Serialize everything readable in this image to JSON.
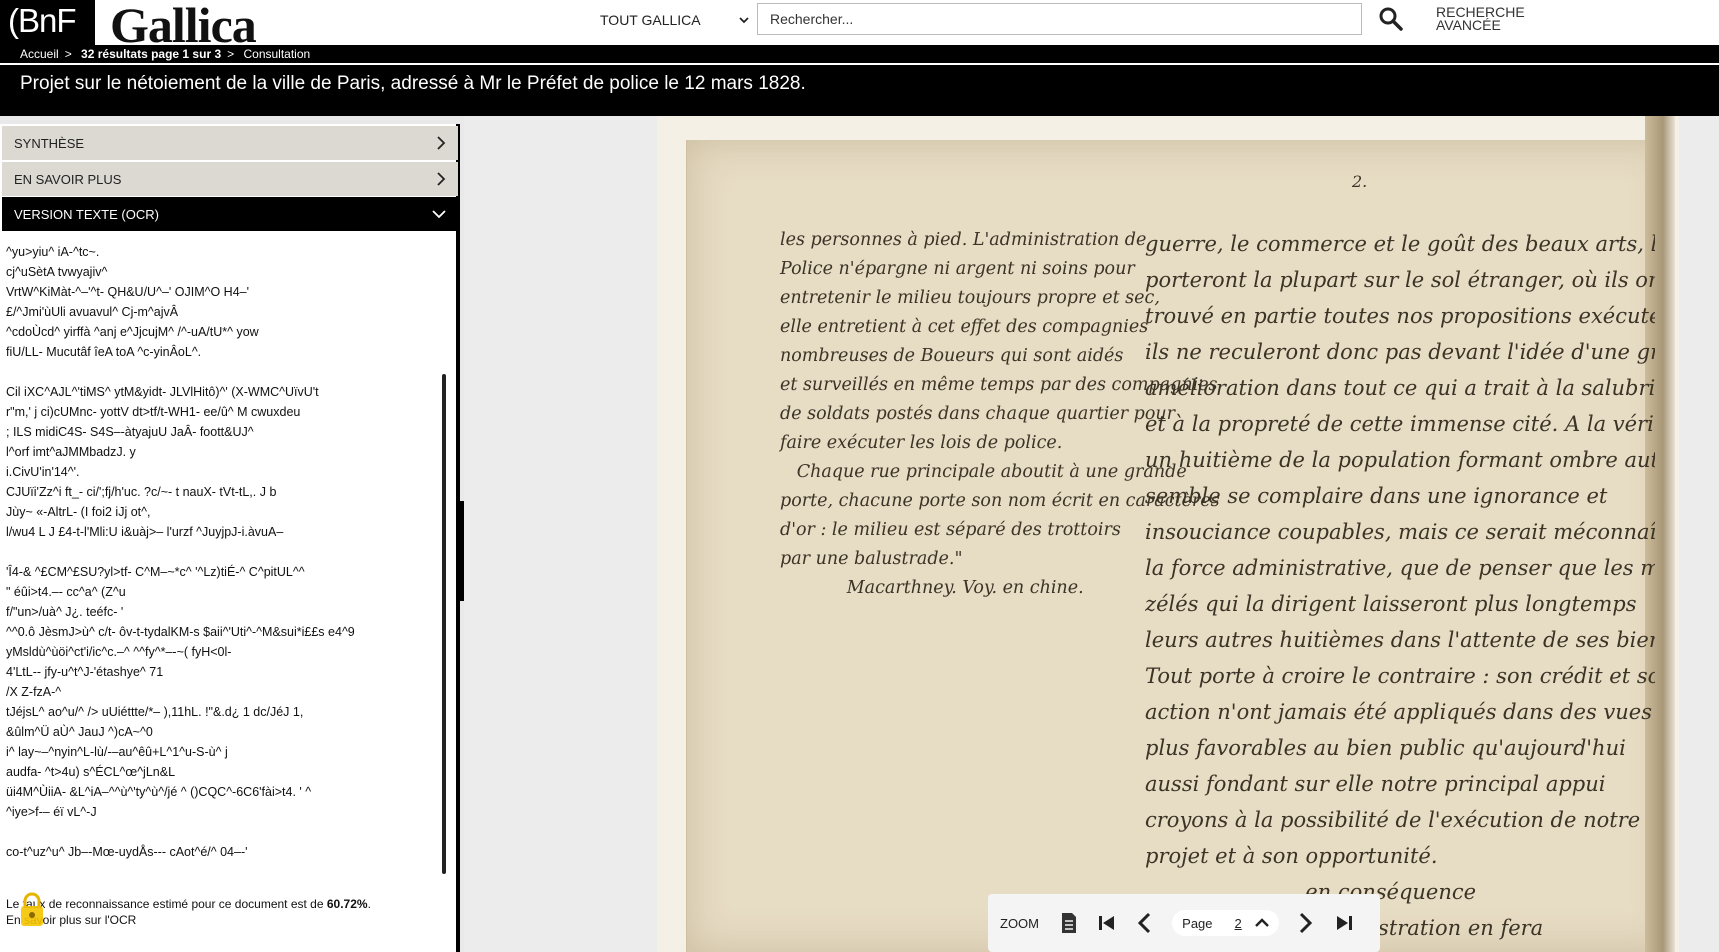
{
  "header": {
    "bnf_logo": "(BnF",
    "gallica_logo": "Gallica",
    "scope": "TOUT GALLICA",
    "search_placeholder": "Rechercher...",
    "advanced_search_line1": "RECHERCHE",
    "advanced_search_line2": "AVANCÉE"
  },
  "breadcrumb": {
    "home": "Accueil",
    "sep": ">",
    "results": "32 résultats page 1 sur 3",
    "current": "Consultation"
  },
  "document": {
    "title": "Projet sur le nétoiement de la ville de Paris, adressé à Mr le Préfet de police le 12 mars 1828."
  },
  "sidebar": {
    "accordion": [
      {
        "label": "SYNTHÈSE"
      },
      {
        "label": "EN SAVOIR PLUS"
      },
      {
        "label": "VERSION TEXTE (OCR)"
      }
    ],
    "ocr_text": "^yu>yiu^ iA-^tc~.\ncj^uSètA tvwyajiv^\nVrtW^KiMàt-^–'^t- QH&U/U^–' OJIM^O H4–'\n£/^Jmi'ùUli avuavul^ Cj-m^ajvÂ\n^cdoÙcd^ yirffà ^anj e^JjcujM^ /^-uA/tU*^ yow\nfiU/LL- Mucutâf îeA toA ^c-yinÂoL^.\n\nCil iXC^AJL^'tiMS^ ytM&yidt- JLVlHitô)^' (X-WMC^UïvU't\nr\"m,' j ci)cUMnc- yottV dt>tf/t-WH1- ee/û^ M cwuxdeu\n; ILS midiC4S- S4S–-àtyajuU JaÂ- foott&UJ^\nl^orf imt^aJMMbadzJ. y\ni.CivU'in'14^'.\nCJUïi'Zz^i ft_- ci/';fj/h'uc. ?c/~- t nauX- tVt-tL,. J b\nJùy~ «-AltrL- (I foi2 iJj ot^,\nl/wu4 L J £4-t-l'Mli:U i&uàj>– l'urzf ^JuyjpJ-i.àvuA–\n\n'Î4-& ^£CM^£SU?yl>tf- C^M–~*c^ '^Lz)tiÉ-^ C^pitUL^^\n\" éûi>t4.–- cc^a^ (Z^u\nf/\"un>/uà^ J¿. teéfc- '\n^^0.ô JèsmJ>ù^ c/t- ôv-t-tydalKM-s $aii^'Uti^-^M&sui*i££s e4^9\nyMsldù^ùöi^ct'i/ic^c.–^ ^^fy^*–-~( fyH<0l-\n4'LtL-- jfy-u^t^J-'étashye^ 71\n/X Z-fzA-^\ntJéjsL^ ao^u/^ /> uUiéttte/*– ),11hL. !\"&.d¿ 1 dc/JéJ 1,\n&ûlm^Ü aÙ^ JauJ ^)cA~^0\ni^ lay~–^nyin^L-lù/-–au^êû+L^1^u-S-ù^ j\naudfa- ^t>4u) s^ÉCL^œ^jLn&L\nüi4M^ÙiiA- &L^iA–^^ù^'ty^ù^/jé ^ ()CQC^-6C6'fài>t4. ' ^\n^iye>f-– éï vL^-J\n\nco-t^uz^u^ Jb–-Mœ-uydÅs--- cAot^é/^ 04–-'",
    "ocr_rate_prefix": "Le taux de reconnaissance estimé pour ce document est de ",
    "ocr_rate_value": "60.72%",
    "ocr_rate_suffix": ".",
    "ocr_more": "En savoir plus sur l'OCR"
  },
  "viewer": {
    "page_mark": "2.",
    "left_column": "les personnes à pied. L'administration de\nPolice n'épargne ni argent ni soins pour\nentretenir le milieu toujours propre et sec,\nelle entretient à cet effet des compagnies\nnombreuses de Boueurs qui sont aidés\net surveillés en même temps par des compagnies\nde soldats postés dans chaque quartier pour\nfaire exécuter les lois de police.\n   Chaque rue principale aboutit à une grande\nporte, chacune porte son nom écrit en caractères\nd'or : le milieu est séparé des trottoirs\npar une balustrade.\"\n            Macarthney. Voy. en chine.",
    "right_column": "guerre, le commerce et le goût des beaux arts, les\nporteront la plupart sur le sol étranger, où ils ont\ntrouvé en partie toutes nos propositions exécutées\nils ne reculeront donc pas devant l'idée d'une grande\namélioration dans tout ce qui a trait à la salubrité\net à la propreté de cette immense cité. A la vérité\nun huitième de la population formant ombre autour\nsemble se complaire dans une ignorance et\ninsouciance coupables, mais ce serait méconnaître\nla force administrative, que de penser que les magistrats\nzélés qui la dirigent laisseront plus longtemps\nleurs autres huitièmes dans l'attente de ses bienfaits\nTout porte à croire le contraire : son crédit et son\naction n'ont jamais été appliqués dans des vues\nplus favorables au bien public qu'aujourd'hui\naussi fondant sur elle notre principal appui\ncroyons à la possibilité de l'exécution de notre\nprojet et à son opportunité.\n                    ... en conséquence\n                    ... administration en fera"
  },
  "page_nav": {
    "zoom": "ZOOM",
    "page_label": "Page",
    "page_value": "2"
  }
}
